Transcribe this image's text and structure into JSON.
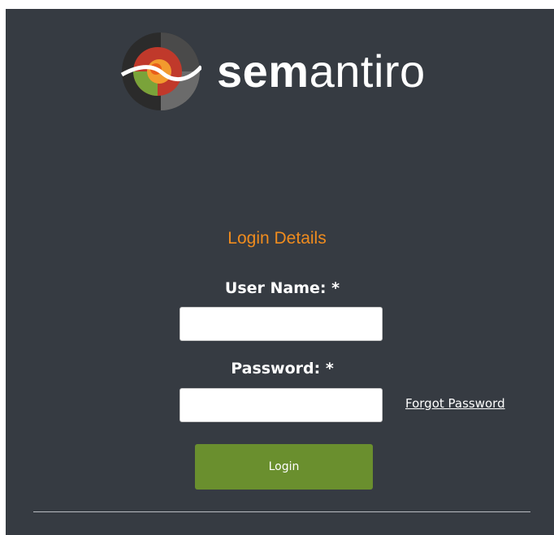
{
  "brand": {
    "name_bold": "sem",
    "name_light": "antiro",
    "logo_icon": "semantiro-logo-icon"
  },
  "form": {
    "title": "Login Details",
    "username_label": "User Name: *",
    "password_label": "Password: *",
    "username_value": "",
    "password_value": "",
    "forgot_password_label": "Forgot Password",
    "login_button_label": "Login"
  },
  "colors": {
    "background": "#363b42",
    "accent_orange": "#f08c1e",
    "button_green": "#6a8f2e",
    "text_white": "#ffffff"
  }
}
